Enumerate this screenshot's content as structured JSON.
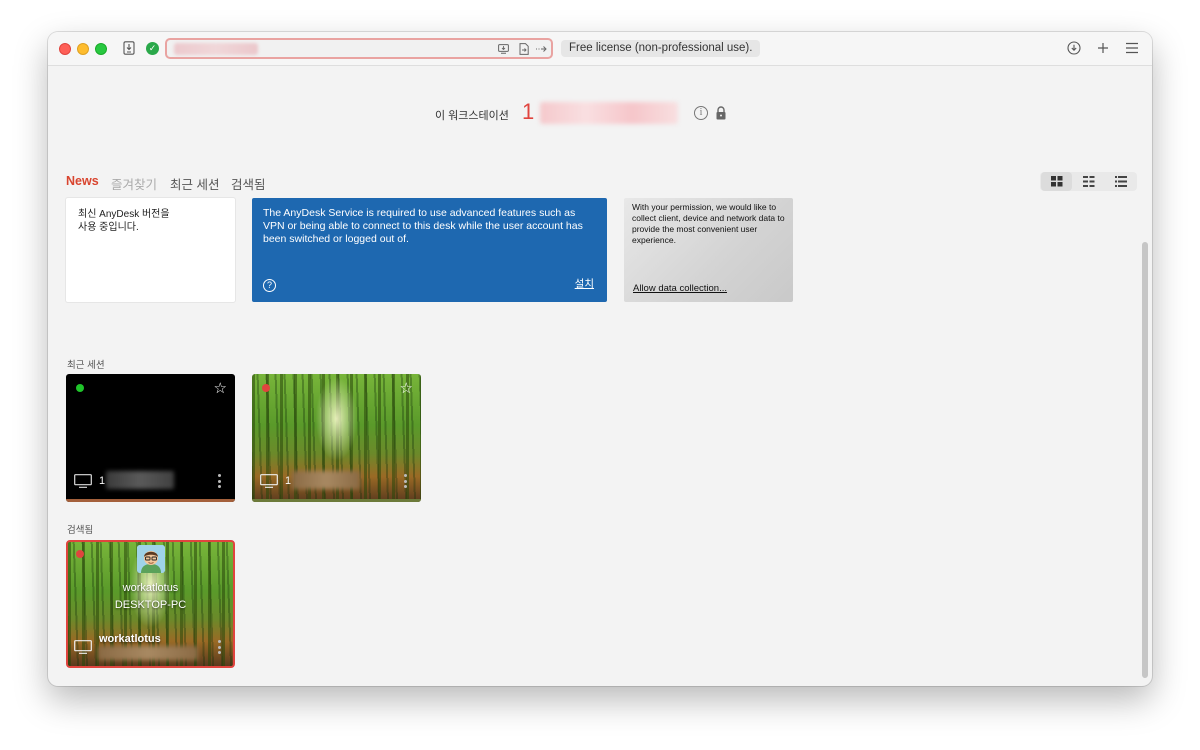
{
  "titlebar": {
    "license_label": "Free license (non-professional use)."
  },
  "workspace": {
    "label": "이 워크스테이션",
    "id_prefix": "1"
  },
  "tabs": [
    {
      "label": "News",
      "active": true
    },
    {
      "label": "즐겨찾기",
      "active": false
    },
    {
      "label": "최근 세션",
      "active": false
    },
    {
      "label": "검색됨",
      "active": false
    }
  ],
  "view_modes": [
    "grid-large-icon",
    "grid-small-icon",
    "list-icon"
  ],
  "news": {
    "version_card": "최신 AnyDesk 버전을\n사용 중입니다.",
    "service_card": {
      "text": "The AnyDesk Service is required to use advanced features such as VPN or being able to connect to this desk while the user account has been switched or logged out of.",
      "install_label": "설치"
    },
    "data_card": {
      "text": "With your permission, we would like to collect client, device and network data to provide the most convenient user experience.",
      "link_label": "Allow data collection..."
    }
  },
  "recent_sessions": {
    "section_label": "최근 세션",
    "items": [
      {
        "id_prefix": "1",
        "status": "online",
        "status_color": "#1fc42a",
        "background": "black"
      },
      {
        "id_prefix": "1",
        "status": "offline",
        "status_color": "#e0443e",
        "background": "bamboo"
      }
    ]
  },
  "discovered": {
    "section_label": "검색됨",
    "items": [
      {
        "username": "workatlotus",
        "hostname": "DESKTOP-PC",
        "alias": "workatlotus",
        "status_color": "#e0443e"
      }
    ]
  },
  "colors": {
    "accent": "#d9452f",
    "selection_border": "#e0443e",
    "service_card_blue": "#1e68b0"
  }
}
